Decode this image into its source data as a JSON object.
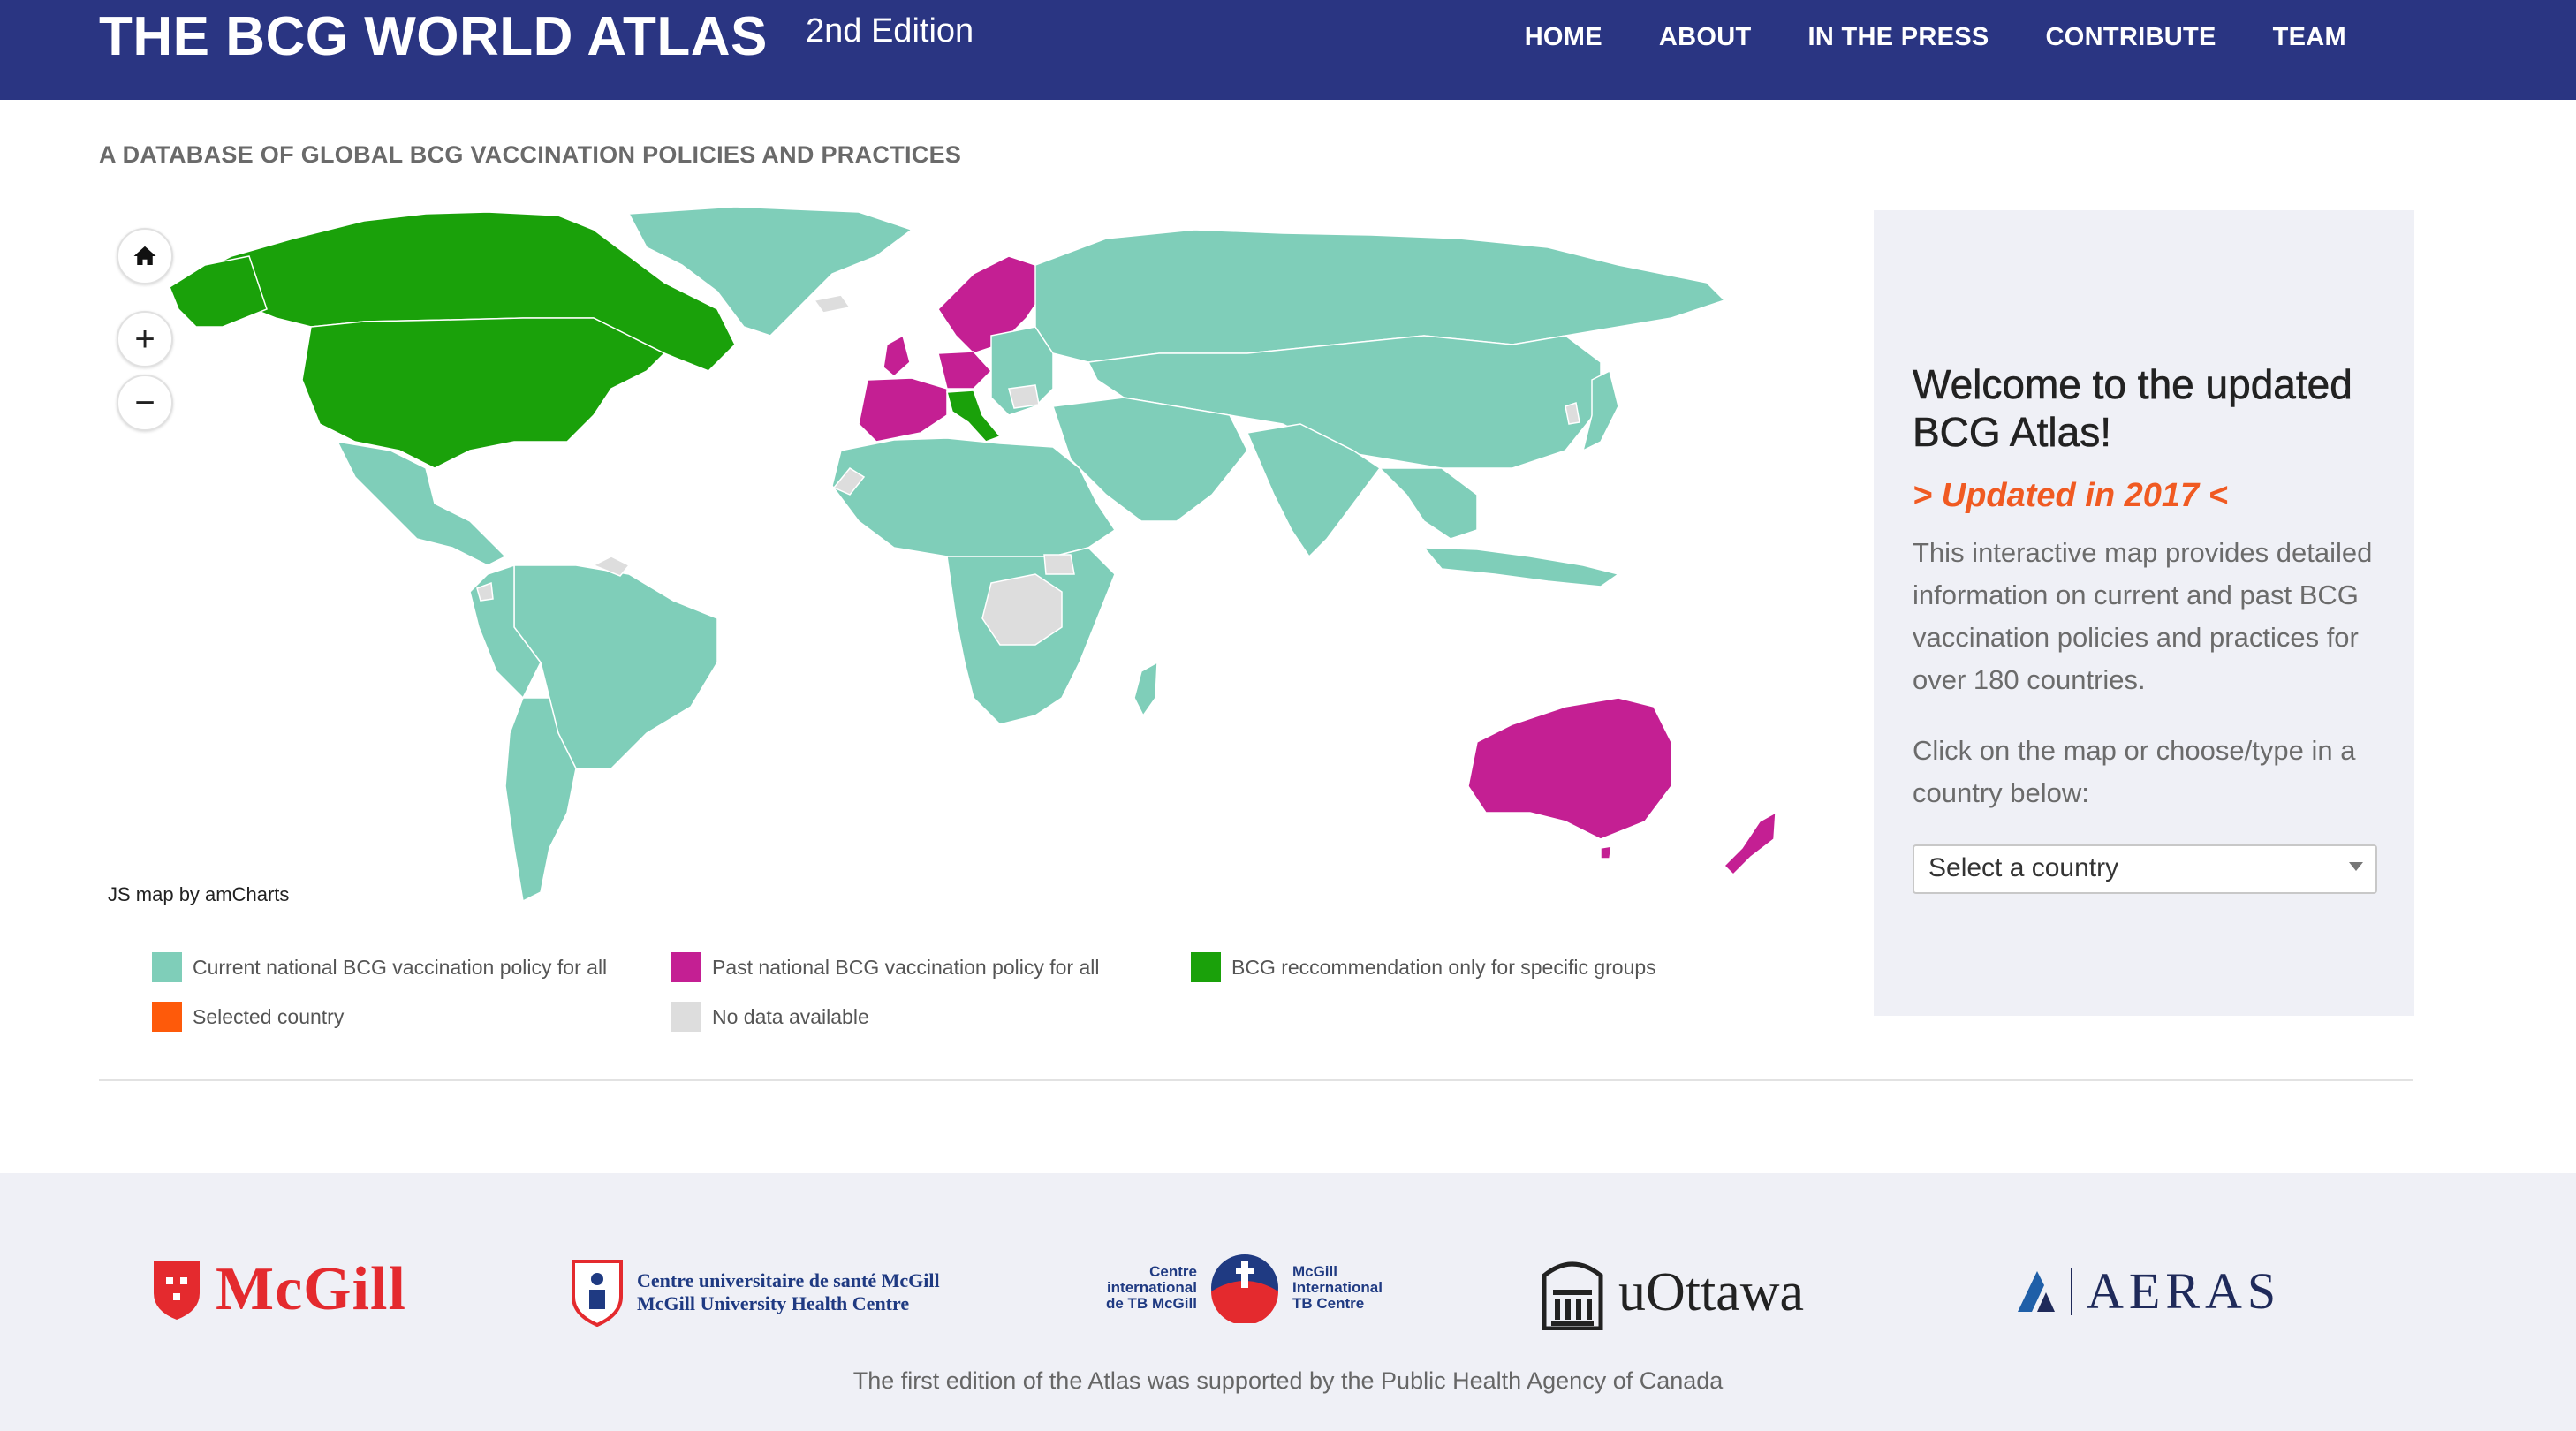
{
  "header": {
    "title": "THE BCG WORLD ATLAS",
    "edition": "2nd Edition",
    "nav": [
      "HOME",
      "ABOUT",
      "IN THE PRESS",
      "CONTRIBUTE",
      "TEAM"
    ],
    "background": "#2a3582"
  },
  "subtitle": "A DATABASE OF GLOBAL BCG VACCINATION POLICIES AND PRACTICES",
  "map": {
    "credit": "JS map by amCharts",
    "controls": {
      "home": "home-icon",
      "zoom_in": "+",
      "zoom_out": "−"
    },
    "colors": {
      "current": "#7fceb9",
      "past": "#c41f93",
      "specific": "#1aa10a",
      "selected": "#fe5a0a",
      "nodata": "#dddddd"
    }
  },
  "legend": {
    "current": "Current national BCG vaccination policy for all",
    "past": "Past national BCG vaccination policy for all",
    "specific": "BCG reccommendation only for specific groups",
    "selected": "Selected country",
    "nodata": "No data available"
  },
  "panel": {
    "heading": "Welcome to the updated BCG Atlas!",
    "updated": "> Updated in 2017 <",
    "info": "This interactive map provides detailed information on current and past BCG vaccination policies and practices for over 180 countries.",
    "click": "Click on the map or choose/type in a country below:",
    "select_value": "Select a country"
  },
  "footer": {
    "mcgill": "McGill",
    "muhc_line1": "Centre universitaire de santé McGill",
    "muhc_line2": "McGill University Health Centre",
    "tb_left_1": "Centre",
    "tb_left_2": "international",
    "tb_left_3": "de TB McGill",
    "tb_right_1": "McGill",
    "tb_right_2": "International",
    "tb_right_3": "TB Centre",
    "uottawa": "uOttawa",
    "aeras": "AERAS",
    "note": "The first edition of the Atlas was supported by the Public Health Agency of Canada"
  }
}
